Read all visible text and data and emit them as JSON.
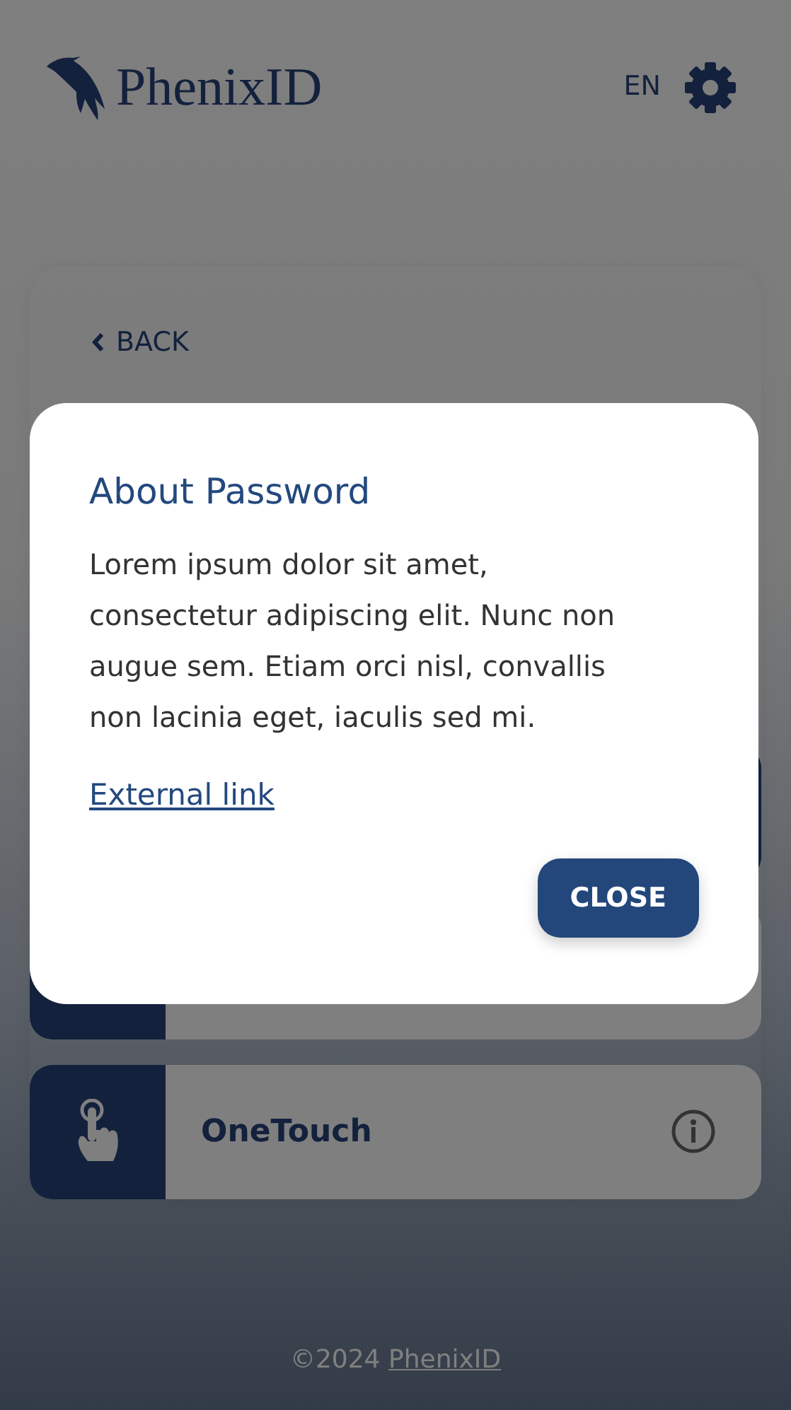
{
  "header": {
    "logo_text": "PhenixID",
    "language": "EN"
  },
  "back": "BACK",
  "methods": [
    {
      "selected": true
    },
    {
      "selected": false
    },
    {
      "label": "OneTouch",
      "selected": false
    }
  ],
  "dialog": {
    "title": "About Password",
    "body": "Lorem ipsum dolor sit amet, consectetur adipiscing elit. Nunc non augue sem. Etiam orci nisl, convallis non lacinia eget, iaculis sed mi.",
    "link": "External link",
    "button": "CLOSE"
  },
  "footer": {
    "copyright": "©2024",
    "link": "PhenixID"
  }
}
